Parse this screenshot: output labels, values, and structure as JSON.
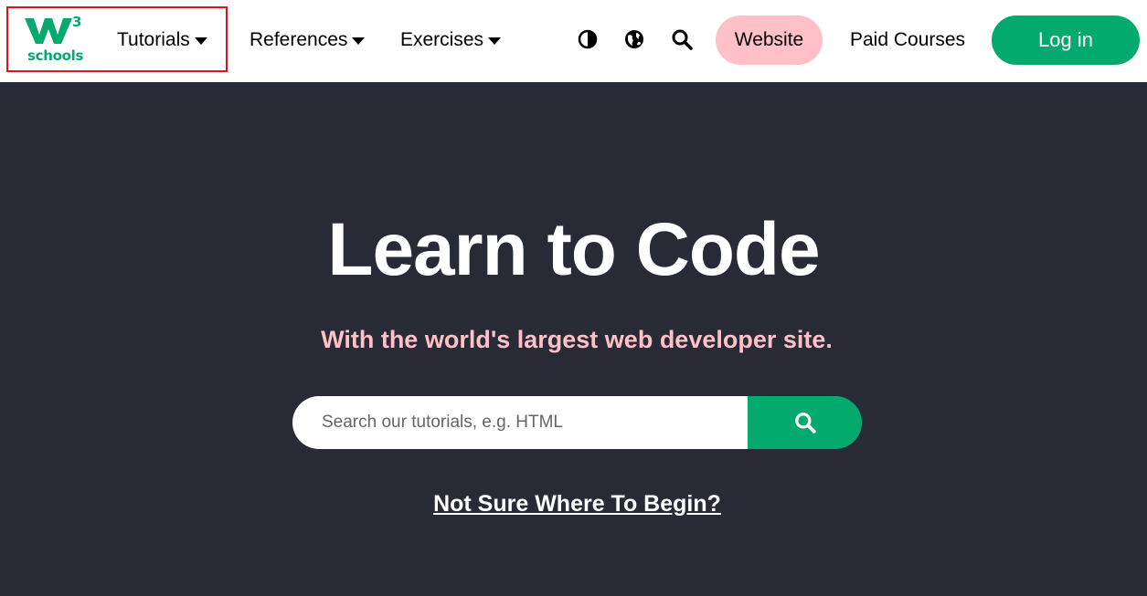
{
  "brand": {
    "logo_text": "schools",
    "logo_superscript": "3",
    "accent_color": "#04aa6d",
    "pink_color": "#ffc0c7",
    "hero_bg": "#282a35"
  },
  "nav": {
    "menus": [
      {
        "label": "Tutorials"
      },
      {
        "label": "References"
      },
      {
        "label": "Exercises"
      }
    ],
    "icons": [
      "contrast-icon",
      "globe-icon",
      "search-icon"
    ],
    "website_label": "Website",
    "paid_courses_label": "Paid Courses",
    "login_label": "Log in"
  },
  "hero": {
    "title": "Learn to Code",
    "subtitle": "With the world's largest web developer site.",
    "search_placeholder": "Search our tutorials, e.g. HTML",
    "search_value": "",
    "begin_link": "Not Sure Where To Begin?"
  }
}
